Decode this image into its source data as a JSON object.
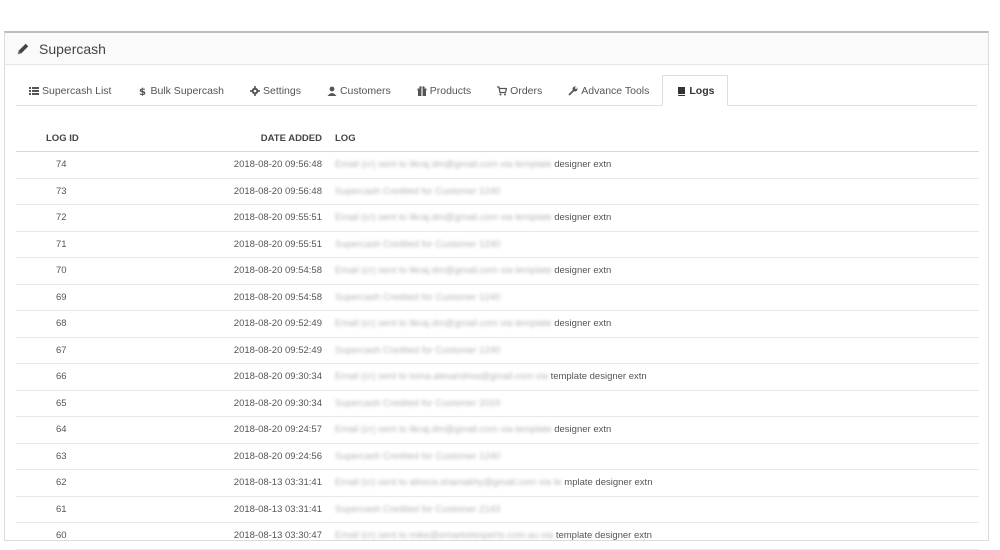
{
  "panel": {
    "title": "Supercash"
  },
  "tabs": [
    {
      "label": "Supercash List",
      "icon": "list-icon",
      "active": false
    },
    {
      "label": "Bulk Supercash",
      "icon": "dollar-icon",
      "active": false
    },
    {
      "label": "Settings",
      "icon": "gear-icon",
      "active": false
    },
    {
      "label": "Customers",
      "icon": "user-icon",
      "active": false
    },
    {
      "label": "Products",
      "icon": "gift-icon",
      "active": false
    },
    {
      "label": "Orders",
      "icon": "cart-icon",
      "active": false
    },
    {
      "label": "Advance Tools",
      "icon": "wrench-icon",
      "active": false
    },
    {
      "label": "Logs",
      "icon": "book-icon",
      "active": true
    }
  ],
  "table": {
    "headers": {
      "id": "LOG ID",
      "date": "DATE ADDED",
      "log": "LOG"
    },
    "rows": [
      {
        "id": "74",
        "date": "2018-08-20 09:56:48",
        "log_hidden": "Email (cr) sent to likraj.dm@gmail.com via template",
        "log_visible": "designer extn"
      },
      {
        "id": "73",
        "date": "2018-08-20 09:56:48",
        "log_hidden": "Supercash Credited for Customer 1240",
        "log_visible": ""
      },
      {
        "id": "72",
        "date": "2018-08-20 09:55:51",
        "log_hidden": "Email (cr) sent to likraj.dm@gmail.com via template",
        "log_visible": "designer extn"
      },
      {
        "id": "71",
        "date": "2018-08-20 09:55:51",
        "log_hidden": "Supercash Credited for Customer 1240",
        "log_visible": ""
      },
      {
        "id": "70",
        "date": "2018-08-20 09:54:58",
        "log_hidden": "Email (cr) sent to likraj.dm@gmail.com via template",
        "log_visible": "designer extn"
      },
      {
        "id": "69",
        "date": "2018-08-20 09:54:58",
        "log_hidden": "Supercash Credited for Customer 1240",
        "log_visible": ""
      },
      {
        "id": "68",
        "date": "2018-08-20 09:52:49",
        "log_hidden": "Email (cr) sent to likraj.dm@gmail.com via template",
        "log_visible": "designer extn"
      },
      {
        "id": "67",
        "date": "2018-08-20 09:52:49",
        "log_hidden": "Supercash Credited for Customer 1240",
        "log_visible": ""
      },
      {
        "id": "66",
        "date": "2018-08-20 09:30:34",
        "log_hidden": "Email (cr) sent to toma.alexandrea@gmail.com via",
        "log_visible": "template designer extn"
      },
      {
        "id": "65",
        "date": "2018-08-20 09:30:34",
        "log_hidden": "Supercash Credited for Customer 2019",
        "log_visible": ""
      },
      {
        "id": "64",
        "date": "2018-08-20 09:24:57",
        "log_hidden": "Email (cr) sent to likraj.dm@gmail.com via template",
        "log_visible": "designer extn"
      },
      {
        "id": "63",
        "date": "2018-08-20 09:24:56",
        "log_hidden": "Supercash Credited for Customer 1240",
        "log_visible": ""
      },
      {
        "id": "62",
        "date": "2018-08-13 03:31:41",
        "log_hidden": "Email (cr) sent to alireza.shamakhy@gmail.com via te",
        "log_visible": "mplate designer extn"
      },
      {
        "id": "61",
        "date": "2018-08-13 03:31:41",
        "log_hidden": "Supercash Credited for Customer 2143",
        "log_visible": ""
      },
      {
        "id": "60",
        "date": "2018-08-13 03:30:47",
        "log_hidden": "Email (cr) sent to mike@emarketexperts.com.au via",
        "log_visible": "template designer extn"
      }
    ]
  }
}
